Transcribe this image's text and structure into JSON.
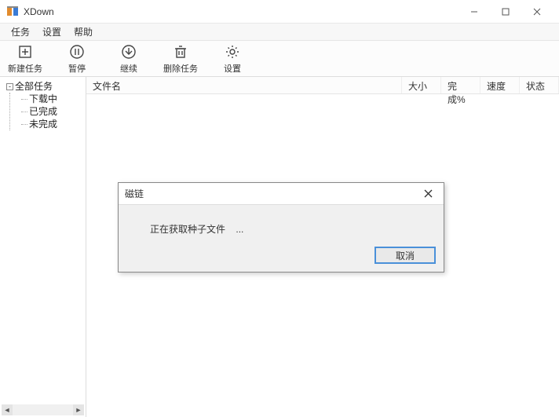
{
  "window": {
    "title": "XDown",
    "controls": {
      "minimize": "—",
      "maximize": "□",
      "close": "✕"
    }
  },
  "menubar": {
    "items": [
      "任务",
      "设置",
      "帮助"
    ]
  },
  "toolbar": {
    "new_task": "新建任务",
    "pause": "暂停",
    "resume": "继续",
    "delete": "删除任务",
    "settings": "设置"
  },
  "sidebar": {
    "root": "全部任务",
    "children": [
      "下载中",
      "已完成",
      "未完成"
    ],
    "collapse_glyph": "-"
  },
  "columns": {
    "name": "文件名",
    "size": "大小",
    "progress": "完成%",
    "speed": "速度",
    "status": "状态"
  },
  "dialog": {
    "title": "磁链",
    "message": "正在获取种子文件",
    "ellipsis": "...",
    "cancel": "取消"
  }
}
